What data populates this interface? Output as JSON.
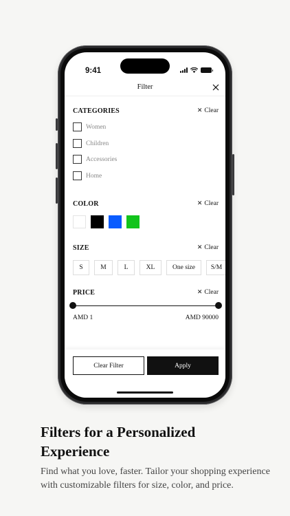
{
  "status": {
    "time": "9:41"
  },
  "nav": {
    "title": "Filter"
  },
  "categories": {
    "title": "CATEGORIES",
    "clear": "Clear",
    "items": [
      "Women",
      "Children",
      "Accessories",
      "Home"
    ]
  },
  "color": {
    "title": "COLOR",
    "clear": "Clear",
    "swatches": [
      "#ffffff",
      "#000000",
      "#0a5cff",
      "#12c41c"
    ]
  },
  "size": {
    "title": "SIZE",
    "clear": "Clear",
    "options": [
      "S",
      "M",
      "L",
      "XL",
      "One size",
      "S/M"
    ]
  },
  "price": {
    "title": "PRICE",
    "clear": "Clear",
    "min_label": "AMD 1",
    "max_label": "AMD 90000"
  },
  "actions": {
    "clear_filter": "Clear Filter",
    "apply": "Apply"
  },
  "promo": {
    "headline": "Filters for a Personalized Experience",
    "body": "Find what you love, faster. Tailor your shopping experience with customizable filters for size, color, and price."
  }
}
